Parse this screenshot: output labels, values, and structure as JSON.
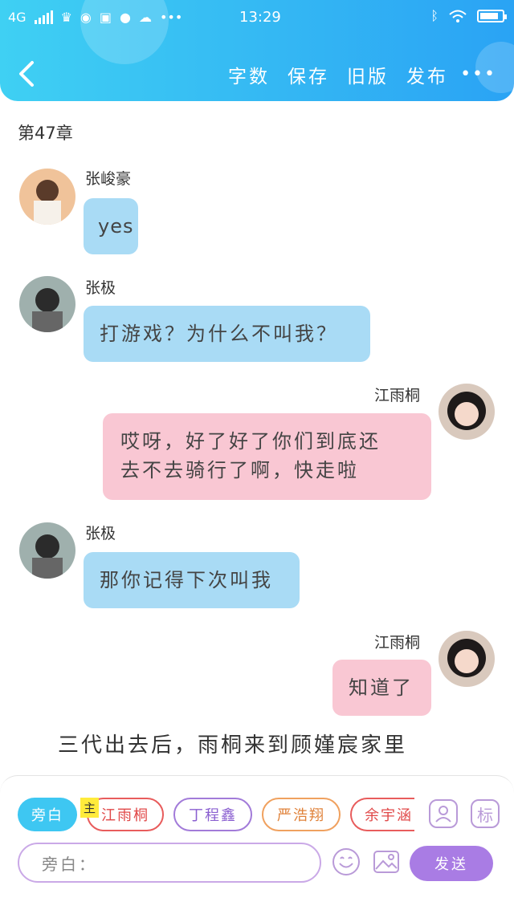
{
  "status_bar": {
    "network": "4G",
    "time": "13:29"
  },
  "toolbar": {
    "word_count": "字数",
    "save": "保存",
    "old_version": "旧版",
    "publish": "发布",
    "more": "•••"
  },
  "chapter_title": "第47章",
  "messages": [
    {
      "name": "张峻豪",
      "text": "yes",
      "side": "left",
      "color": "blue"
    },
    {
      "name": "张极",
      "text": "打游戏？为什么不叫我？",
      "side": "left",
      "color": "blue"
    },
    {
      "name": "江雨桐",
      "text_line1": "哎呀，好了好了你们到底还",
      "text_line2": "去不去骑行了啊，快走啦",
      "side": "right",
      "color": "pink"
    },
    {
      "name": "张极",
      "text": "那你记得下次叫我",
      "side": "left",
      "color": "blue"
    },
    {
      "name": "江雨桐",
      "text": "知道了",
      "side": "right",
      "color": "pink"
    }
  ],
  "narration": "三代出去后，雨桐来到顾嫤宸家里",
  "composer": {
    "chips": [
      "旁白",
      "江雨桐",
      "丁程鑫",
      "严浩翔",
      "余宇涵"
    ],
    "main_tag": "主",
    "right_icons": [
      "person-icon",
      "标"
    ],
    "placeholder": "旁白：",
    "send": "发送"
  },
  "colors": {
    "header": "#34b7f3",
    "blue_bubble": "#a9dbf5",
    "pink_bubble": "#f9c7d3",
    "send": "#a97ce4"
  }
}
